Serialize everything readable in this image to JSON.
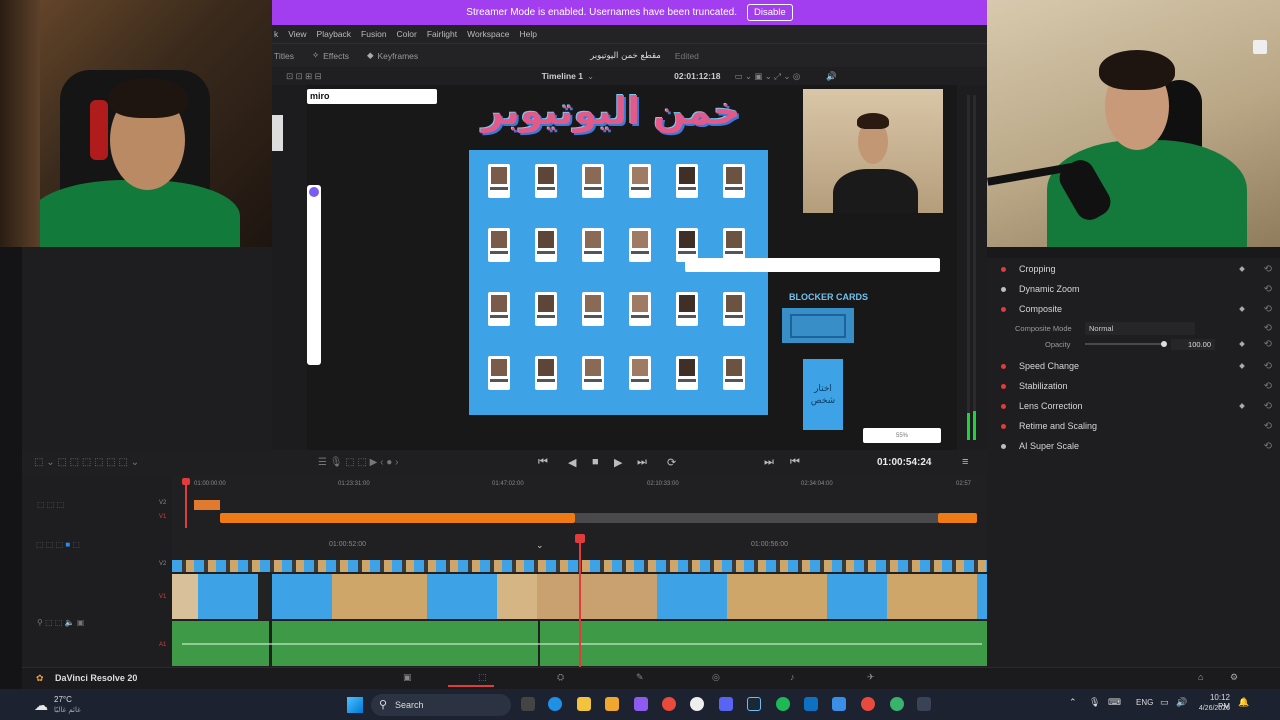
{
  "banner": {
    "message": "Streamer Mode is enabled. Usernames have been truncated.",
    "disable_label": "Disable"
  },
  "menu": [
    "k",
    "View",
    "Playback",
    "Fusion",
    "Color",
    "Fairlight",
    "Workspace",
    "Help"
  ],
  "toolbar": {
    "titles": "Titles",
    "effects": "Effects",
    "keyframes": "Keyframes",
    "project_name": "مقطع خمن اليوتيوبر",
    "edited": "Edited"
  },
  "viewer": {
    "timeline_name": "Timeline 1",
    "timecode": "02:01:12:18"
  },
  "miro": {
    "logo": "miro",
    "zoom": "55%"
  },
  "canvas": {
    "title": "خمن اليوتيوبر",
    "blocker_label": "BLOCKER CARDS",
    "choose_label": "اختار شخص"
  },
  "inspector": {
    "items": [
      {
        "label": "Cropping",
        "dot": "#e13b3b"
      },
      {
        "label": "Dynamic Zoom",
        "dot": "#bdbdbd"
      },
      {
        "label": "Composite",
        "dot": "#e13b3b"
      },
      {
        "label": "Speed Change",
        "dot": "#e13b3b"
      },
      {
        "label": "Stabilization",
        "dot": "#e13b3b"
      },
      {
        "label": "Lens Correction",
        "dot": "#e13b3b"
      },
      {
        "label": "Retime and Scaling",
        "dot": "#e13b3b"
      },
      {
        "label": "AI Super Scale",
        "dot": "#bdbdbd"
      }
    ],
    "composite_mode_label": "Composite Mode",
    "composite_mode_value": "Normal",
    "opacity_label": "Opacity",
    "opacity_value": "100.00"
  },
  "transport": {
    "timecode": "01:00:54:24"
  },
  "upper_ruler": [
    "01:00:00:00",
    "01:23:31:00",
    "01:47:02:00",
    "02:10:33:00",
    "02:34:04:00",
    "02:57"
  ],
  "lower_ruler": [
    "01:00:52:00",
    "01:00:56:00"
  ],
  "tracks": {
    "v2": "V2",
    "v1": "V1",
    "a1": "A1"
  },
  "app": {
    "name": "DaVinci Resolve 20"
  },
  "taskbar": {
    "weather_temp": "27°C",
    "weather_text": "غائم غالبًا",
    "search": "Search",
    "time": "10:12 PM",
    "date": "4/26/2026",
    "lang": "ENG"
  },
  "colors": {
    "resolve_bg": "#1b1b1d",
    "banner": "#a23ef0",
    "clip_orange": "#f07a14",
    "audio_green": "#3e9a47",
    "board_blue": "#3ea3e6"
  }
}
